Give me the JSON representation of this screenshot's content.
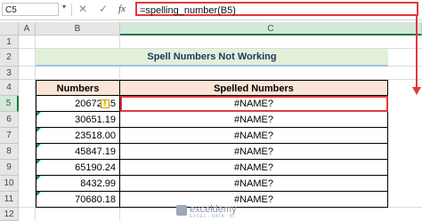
{
  "formula_bar": {
    "name_box": "C5",
    "formula": "=spelling_number(B5)",
    "cancel_icon": "x-icon",
    "enter_icon": "check-icon",
    "fx_label": "fx"
  },
  "columns": [
    "A",
    "B",
    "C"
  ],
  "rows": [
    "1",
    "2",
    "3",
    "4",
    "5",
    "6",
    "7",
    "8",
    "9",
    "10",
    "11",
    "12"
  ],
  "title": "Spell Numbers Not Working",
  "table": {
    "headers": {
      "numbers": "Numbers",
      "spelled": "Spelled Numbers"
    },
    "numbers": [
      "20672.45",
      "30651.19",
      "23518.00",
      "45847.19",
      "65190.24",
      "8432.99",
      "70680.18"
    ],
    "spelled": [
      "#NAME?",
      "#NAME?",
      "#NAME?",
      "#NAME?",
      "#NAME?",
      "#NAME?",
      "#NAME?"
    ]
  },
  "warning_icon": "warning-icon",
  "watermark": {
    "name": "exceldemy",
    "tagline": "EXCEL · DATA · BI"
  },
  "colors": {
    "accent_red": "#e0393e",
    "title_fill": "#e2f0d9",
    "header_fill": "#fbe5d6",
    "excel_green": "#217346"
  }
}
